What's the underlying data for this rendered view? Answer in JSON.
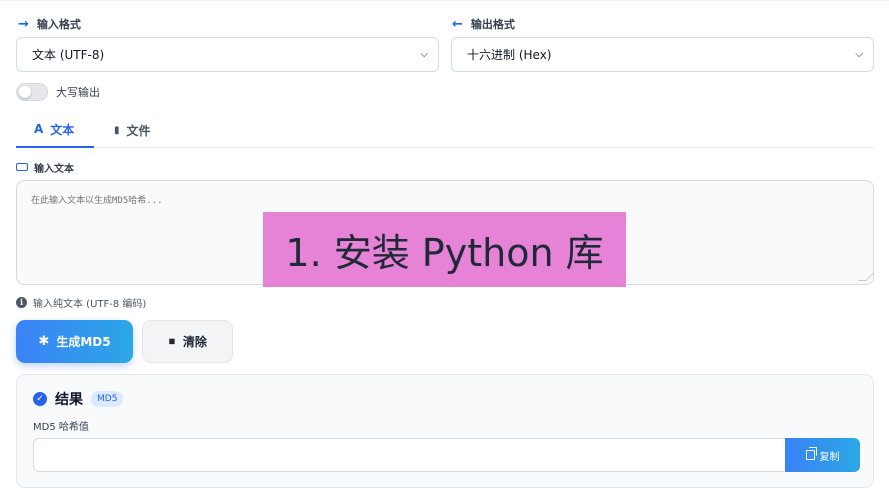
{
  "input_format": {
    "label": "输入格式",
    "arrow": "→",
    "selected": "文本 (UTF-8)"
  },
  "output_format": {
    "label": "输出格式",
    "arrow": "←",
    "selected": "十六进制 (Hex)"
  },
  "uppercase_toggle": {
    "label": "大写输出",
    "enabled": false
  },
  "tabs": [
    {
      "label": "文本",
      "icon": "font-icon",
      "glyph": "A",
      "active": true
    },
    {
      "label": "文件",
      "icon": "file-icon",
      "glyph": "▮",
      "active": false
    }
  ],
  "input_section": {
    "label": "输入文本",
    "placeholder": "在此输入文本以生成MD5哈希...",
    "value": "",
    "hint": "输入纯文本 (UTF-8 编码)"
  },
  "actions": {
    "generate_label": "生成MD5",
    "generate_glyph": "✱",
    "clear_label": "清除",
    "clear_glyph": "◆"
  },
  "result": {
    "title": "结果",
    "check_glyph": "✓",
    "badge": "MD5",
    "hash_label": "MD5 哈希值",
    "hash_value": "",
    "copy_label": "复制"
  },
  "overlay": {
    "text": "1. 安装 Python 库"
  },
  "colors": {
    "accent": "#2563eb",
    "overlay": "#e783d6"
  }
}
